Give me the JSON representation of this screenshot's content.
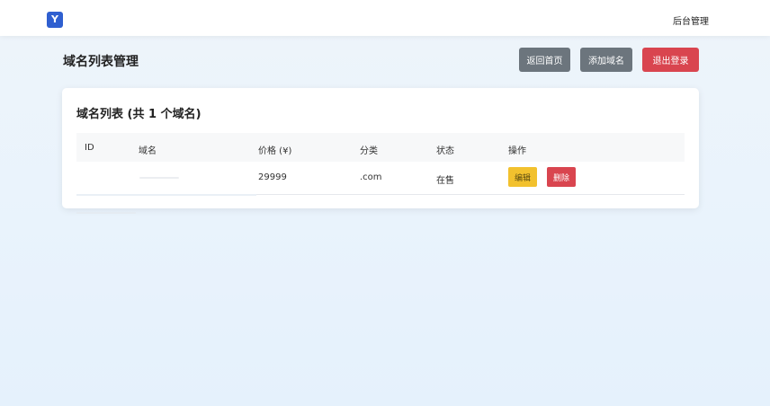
{
  "header": {
    "logo_letter": "Y",
    "admin_link": "后台管理"
  },
  "page": {
    "title": "域名列表管理",
    "buttons": {
      "home": "返回首页",
      "add": "添加域名",
      "logout": "退出登录"
    }
  },
  "card": {
    "title": "域名列表 (共 1 个域名)"
  },
  "table": {
    "columns": [
      "ID",
      "域名",
      "价格 (¥)",
      "分类",
      "状态",
      "操作"
    ],
    "rows": [
      {
        "id": "",
        "domain": "",
        "price": "29999",
        "category": ".com",
        "status": "在售",
        "actions": {
          "edit": "编辑",
          "delete": "删除"
        }
      }
    ]
  },
  "colors": {
    "brand": "#2f5fd0",
    "secondary": "#6c757d",
    "danger": "#d9454f",
    "warning": "#f2c12e"
  }
}
